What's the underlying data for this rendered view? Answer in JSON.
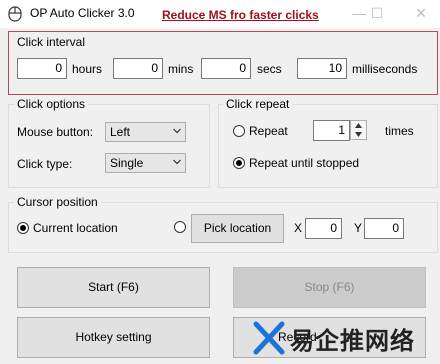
{
  "window": {
    "title": "OP Auto Clicker 3.0",
    "banner": "Reduce MS fro faster clicks",
    "minimize_icon": "minimize-icon",
    "maximize_icon": "maximize-icon",
    "close_icon": "close-icon"
  },
  "click_interval": {
    "label": "Click interval",
    "hours_value": "0",
    "hours_label": "hours",
    "mins_value": "0",
    "mins_label": "mins",
    "secs_value": "0",
    "secs_label": "secs",
    "ms_value": "10",
    "ms_label": "milliseconds"
  },
  "click_options": {
    "label": "Click options",
    "mouse_button_label": "Mouse button:",
    "mouse_button_value": "Left",
    "click_type_label": "Click type:",
    "click_type_value": "Single"
  },
  "click_repeat": {
    "label": "Click repeat",
    "repeat_label": "Repeat",
    "repeat_value": "1",
    "times_label": "times",
    "repeat_until_label": "Repeat until stopped",
    "selected": "repeat_until_stopped"
  },
  "cursor_position": {
    "label": "Cursor position",
    "current_label": "Current location",
    "pick_button": "Pick location",
    "x_label": "X",
    "x_value": "0",
    "y_label": "Y",
    "y_value": "0",
    "selected": "current_location"
  },
  "buttons": {
    "start": "Start (F6)",
    "stop": "Stop (F6)",
    "hotkey": "Hotkey setting",
    "record_partial": "Record"
  },
  "watermark": {
    "text": "易企推网络"
  },
  "colors": {
    "accent_border": "#b54a56",
    "banner": "#a0111b",
    "watermark_blue": "#1e73d8",
    "watermark_text": "#222222"
  }
}
